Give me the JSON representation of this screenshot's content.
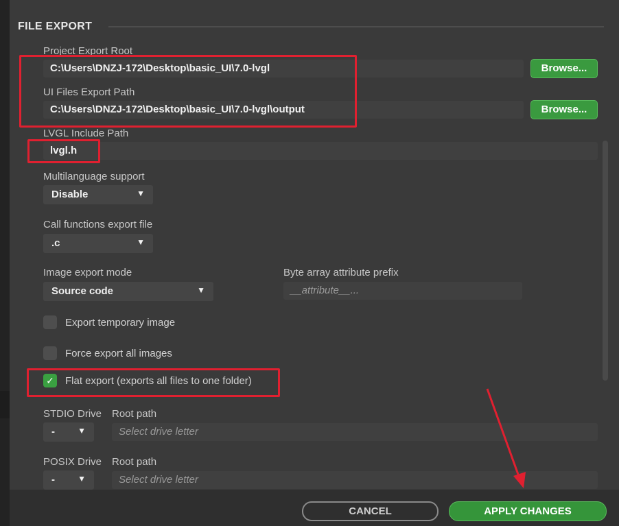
{
  "section": {
    "title": "FILE EXPORT"
  },
  "project_export_root": {
    "label": "Project Export Root",
    "value": "C:\\Users\\DNZJ-172\\Desktop\\basic_UI\\7.0-lvgl",
    "browse_label": "Browse..."
  },
  "ui_files_export_path": {
    "label": "UI Files Export Path",
    "value": "C:\\Users\\DNZJ-172\\Desktop\\basic_UI\\7.0-lvgl\\output",
    "browse_label": "Browse..."
  },
  "lvgl_include_path": {
    "label": "LVGL Include Path",
    "value": "lvgl.h"
  },
  "multilanguage": {
    "label": "Multilanguage support",
    "selected": "Disable"
  },
  "call_functions": {
    "label": "Call functions export file",
    "selected": ".c"
  },
  "image_export_mode": {
    "label": "Image export mode",
    "selected": "Source code"
  },
  "byte_array_prefix": {
    "label": "Byte array attribute prefix",
    "placeholder": "__attribute__..."
  },
  "checkboxes": [
    {
      "label": "Export temporary image",
      "checked": false
    },
    {
      "label": "Force export all images",
      "checked": false
    },
    {
      "label": "Flat export (exports all files to one folder)",
      "checked": true
    }
  ],
  "stdio": {
    "drive_label": "STDIO Drive",
    "drive_selected": "-",
    "root_label": "Root path",
    "root_placeholder": "Select drive letter"
  },
  "posix": {
    "drive_label": "POSIX Drive",
    "drive_selected": "-",
    "root_label": "Root path",
    "root_placeholder": "Select drive letter"
  },
  "footer": {
    "cancel_label": "CANCEL",
    "apply_label": "APPLY CHANGES"
  },
  "icons": {
    "caret": "caret-down-icon",
    "check": "check-icon",
    "arrow": "red-arrow-annotation"
  },
  "colors": {
    "accent_green": "#3a9a3f",
    "annotation_red": "#e02030",
    "panel_bg": "#3a3a3a"
  }
}
